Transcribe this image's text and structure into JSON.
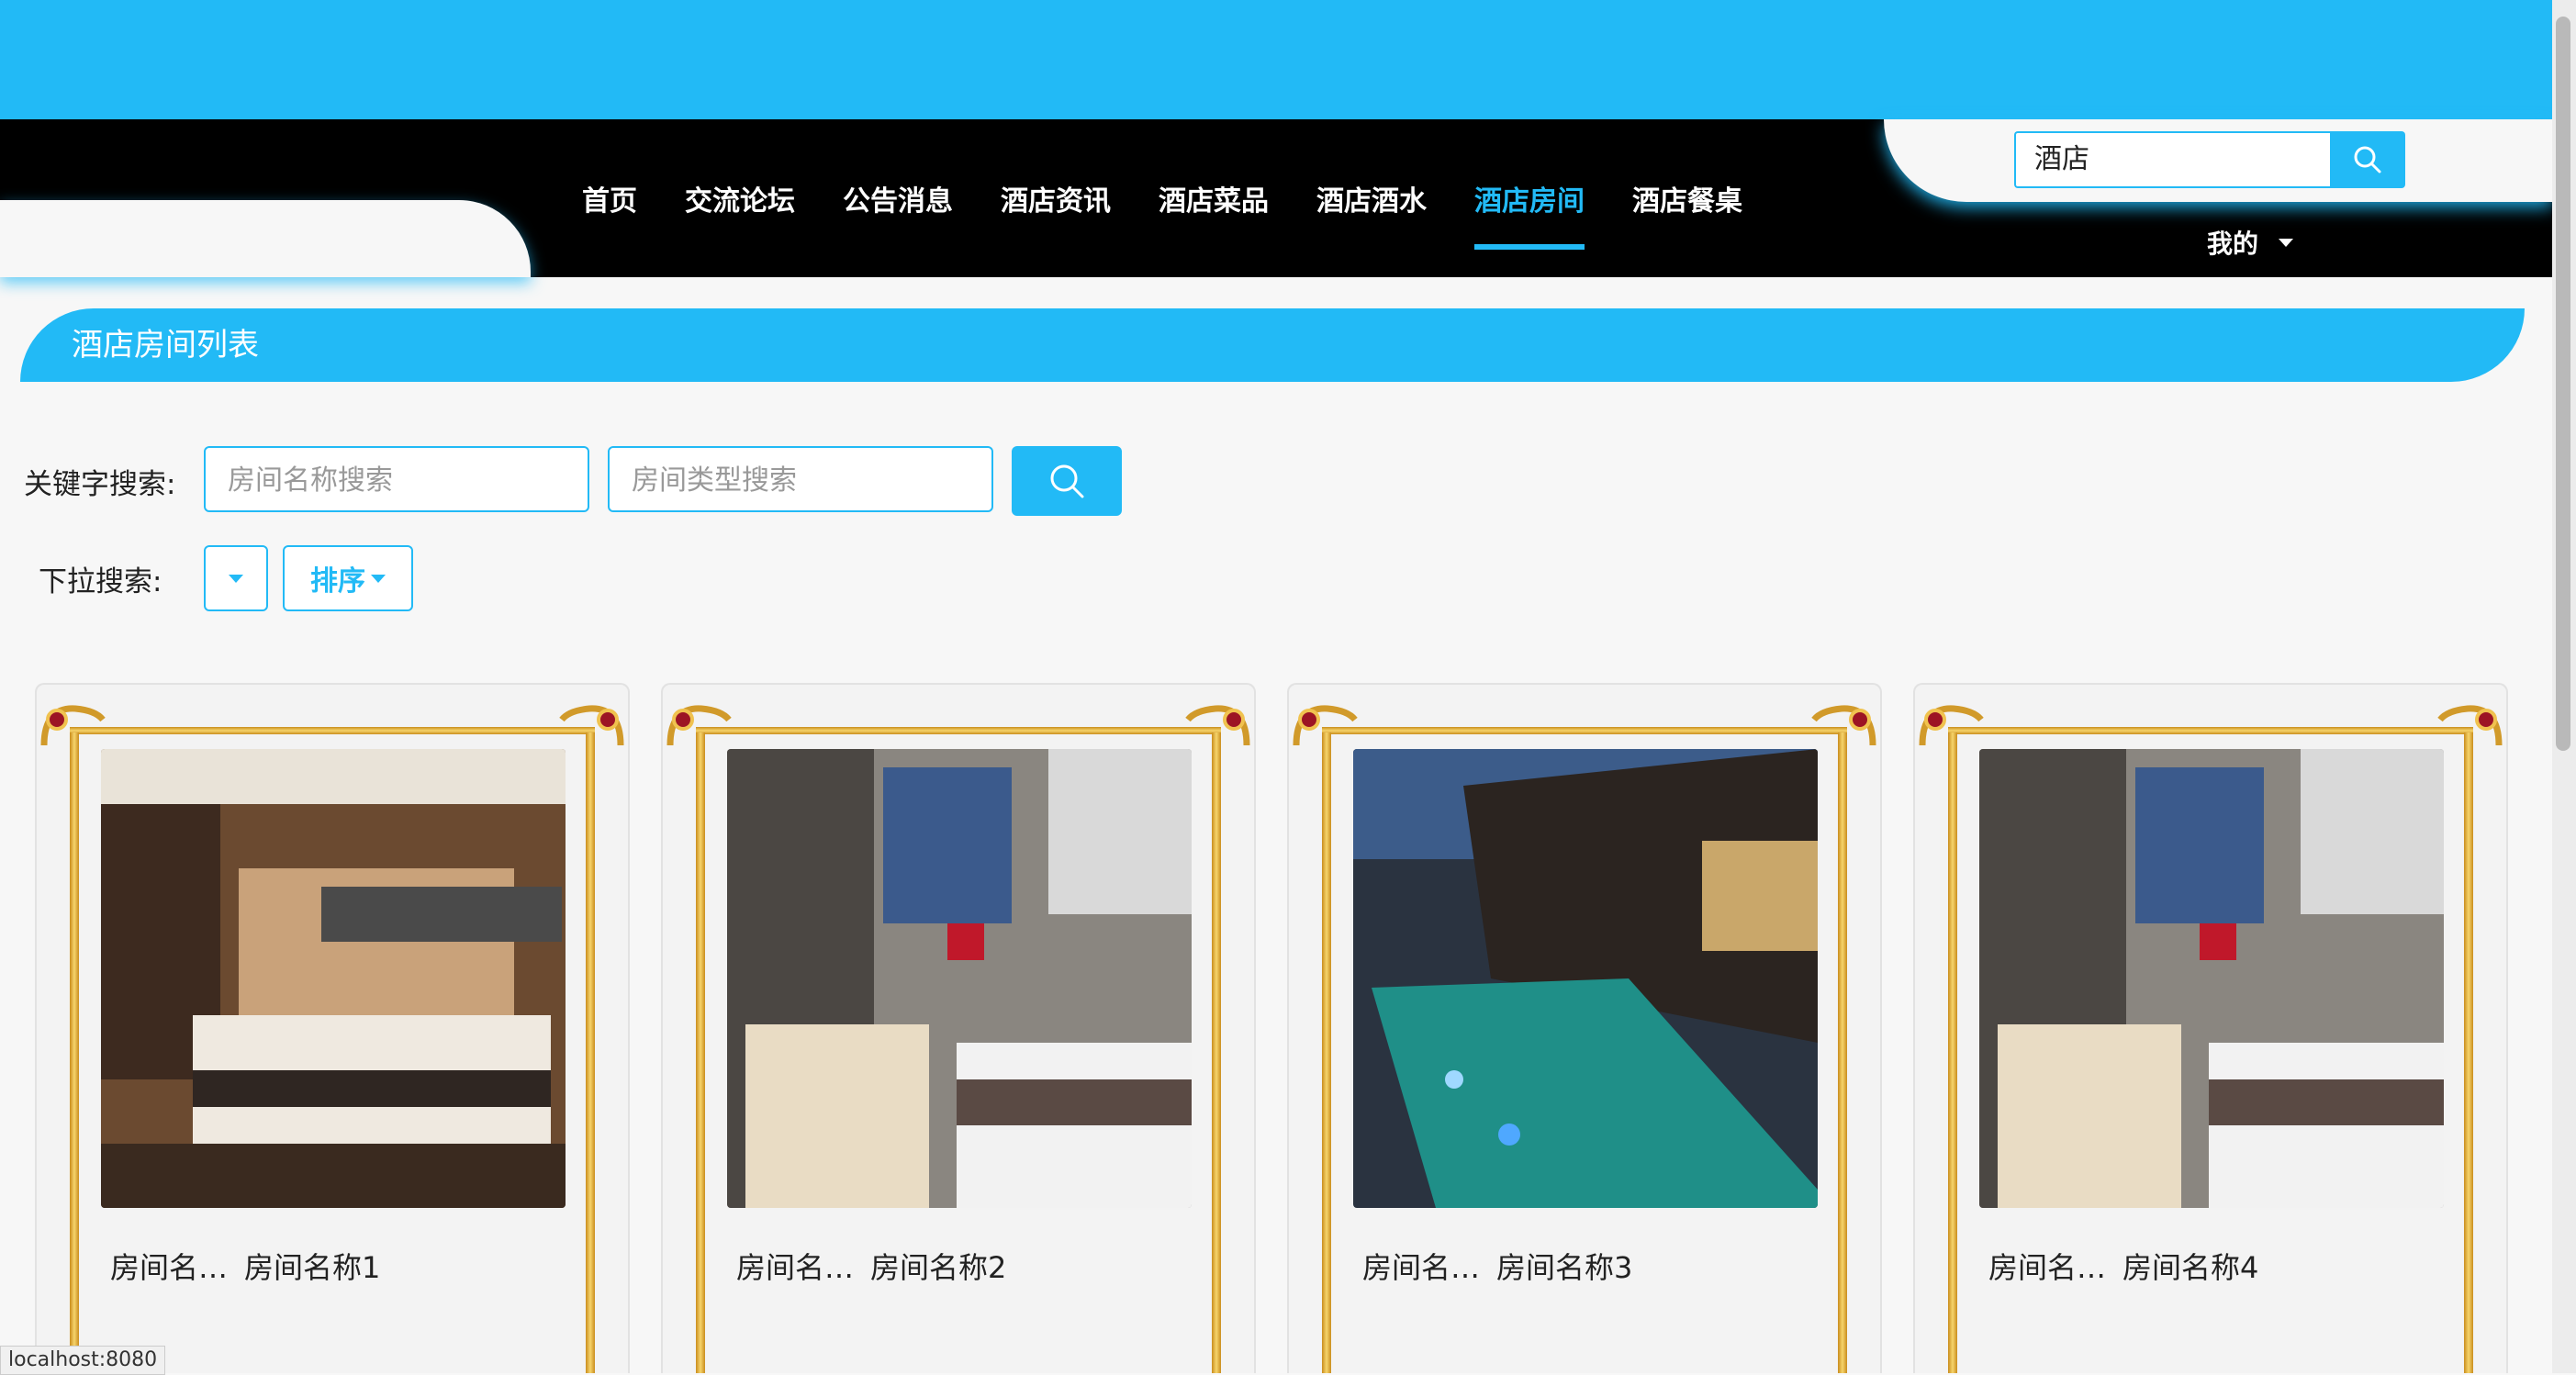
{
  "nav": {
    "items": [
      "首页",
      "交流论坛",
      "公告消息",
      "酒店资讯",
      "酒店菜品",
      "酒店酒水",
      "酒店房间",
      "酒店餐桌"
    ],
    "active": "酒店房间"
  },
  "top_search": {
    "value": "酒店"
  },
  "user_menu": {
    "label": "我的"
  },
  "page": {
    "title": "酒店房间列表"
  },
  "filters": {
    "keyword_label": "关键字搜索:",
    "name_placeholder": "房间名称搜索",
    "type_placeholder": "房间类型搜索",
    "dropdown_label": "下拉搜索:",
    "sort_label": "排序"
  },
  "rooms": [
    {
      "label": "房间名…",
      "name": "房间名称1"
    },
    {
      "label": "房间名…",
      "name": "房间名称2"
    },
    {
      "label": "房间名…",
      "name": "房间名称3"
    },
    {
      "label": "房间名…",
      "name": "房间名称4"
    }
  ],
  "status_bar": {
    "url": "localhost:8080"
  },
  "colors": {
    "accent": "#22baf6",
    "nav_bg": "#000000",
    "page_bg": "#f7f7f7"
  }
}
